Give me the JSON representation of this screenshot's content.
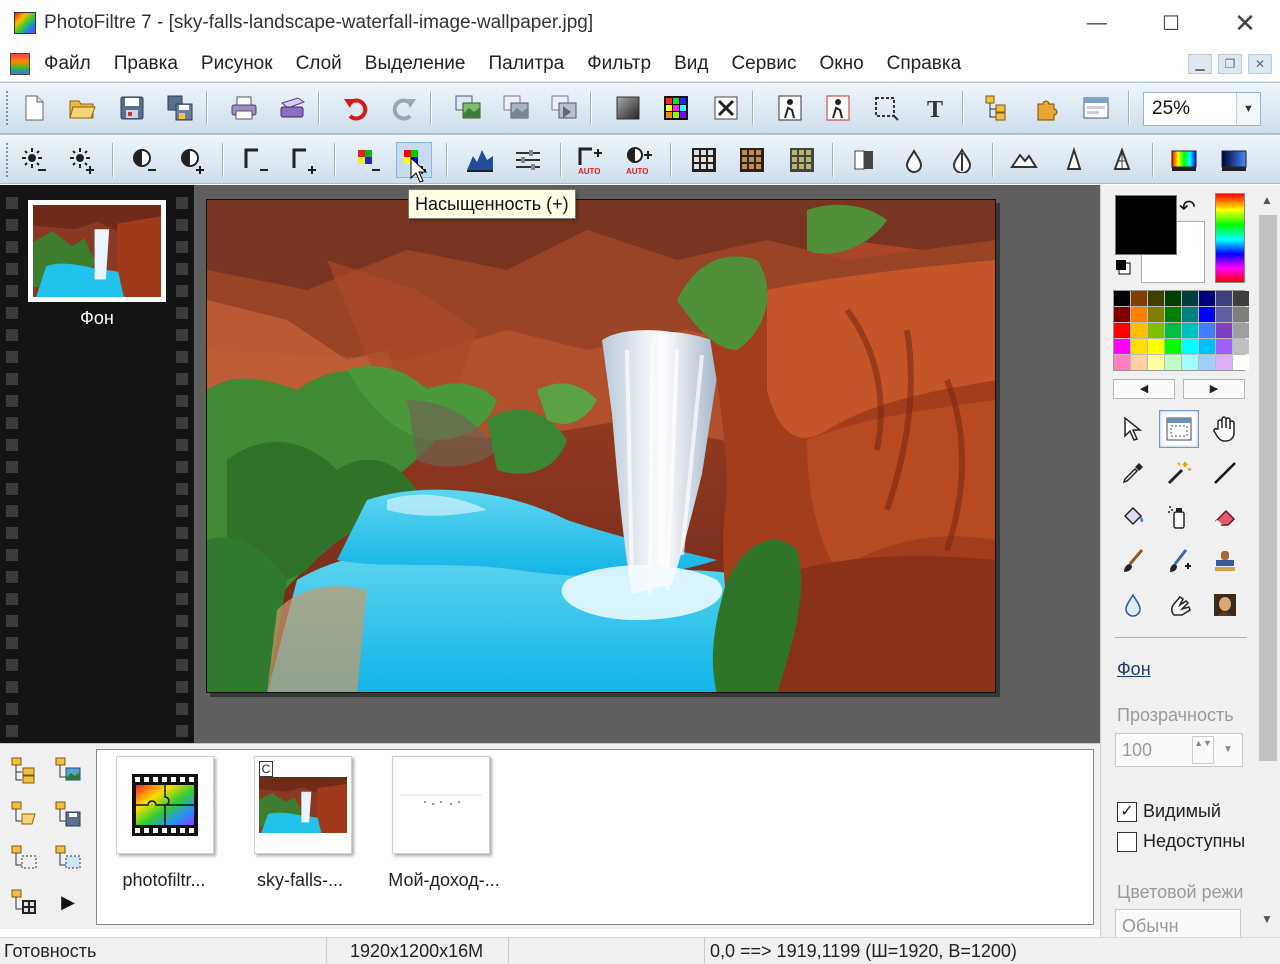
{
  "window": {
    "title": "PhotoFiltre 7 - [sky-falls-landscape-waterfall-image-wallpaper.jpg]",
    "min_glyph": "—",
    "max_glyph": "☐",
    "close_glyph": "✕"
  },
  "menu": {
    "items": [
      "Файл",
      "Правка",
      "Рисунок",
      "Слой",
      "Выделение",
      "Палитра",
      "Фильтр",
      "Вид",
      "Сервис",
      "Окно",
      "Справка"
    ],
    "mdi_min": "▁",
    "mdi_restore": "❐",
    "mdi_close": "✕"
  },
  "toolbar": {
    "zoom_value": "25%",
    "zoom_arrow": "▼"
  },
  "tooltip": {
    "text": "Насыщенность (+)"
  },
  "filmstrip": {
    "layer_name": "Фон"
  },
  "panel": {
    "swap_glyph": "↶",
    "palette_left": "◀",
    "palette_right": "▶",
    "layer_link": "Фон",
    "opacity_label": "Прозрачность",
    "opacity_value": "100",
    "opacity_spin": "▲▼",
    "opacity_drop": "▼",
    "visible_label": "Видимый",
    "visible_checked": "✓",
    "locked_label": "Недоступны",
    "color_mode_label": "Цветовой режи",
    "color_mode_value": "Обычн"
  },
  "scroll": {
    "up": "▲",
    "down": "▼"
  },
  "documents": {
    "items": [
      {
        "label": "photofiltr..."
      },
      {
        "label": "sky-falls-..."
      },
      {
        "label": "Мой-доход-..."
      }
    ],
    "badge": "C",
    "more_glyph": "▶"
  },
  "status": {
    "ready": "Готовность",
    "size": "1920x1200x16M",
    "coords": "0,0 ==> 1919,1199 (Ш=1920, В=1200)"
  },
  "colors": {
    "toolbar_bg": "#cfdeeb",
    "workspace_bg": "#5f5f5f",
    "filmstrip_bg": "#141414",
    "foreground": "#000000",
    "background": "#ffffff",
    "palette": [
      "#000000",
      "#7f3f00",
      "#3f3f00",
      "#003f00",
      "#003f3f",
      "#00007f",
      "#3f3f7f",
      "#3f3f3f",
      "#7f0000",
      "#ff7f00",
      "#7f7f00",
      "#007f00",
      "#007f7f",
      "#0000ff",
      "#5f5f9f",
      "#7f7f7f",
      "#ff0000",
      "#ffbf00",
      "#7fbf00",
      "#00bf3f",
      "#00bfbf",
      "#3f7fff",
      "#7f3fbf",
      "#9f9f9f",
      "#ff00ff",
      "#ffdf00",
      "#ffff00",
      "#00ff00",
      "#00ffff",
      "#00bfff",
      "#9f5fff",
      "#c0c0c0",
      "#ff7fbf",
      "#ffcf9f",
      "#ffff9f",
      "#bfffbf",
      "#9fffff",
      "#9fcfff",
      "#dfafff",
      "#ffffff"
    ]
  }
}
